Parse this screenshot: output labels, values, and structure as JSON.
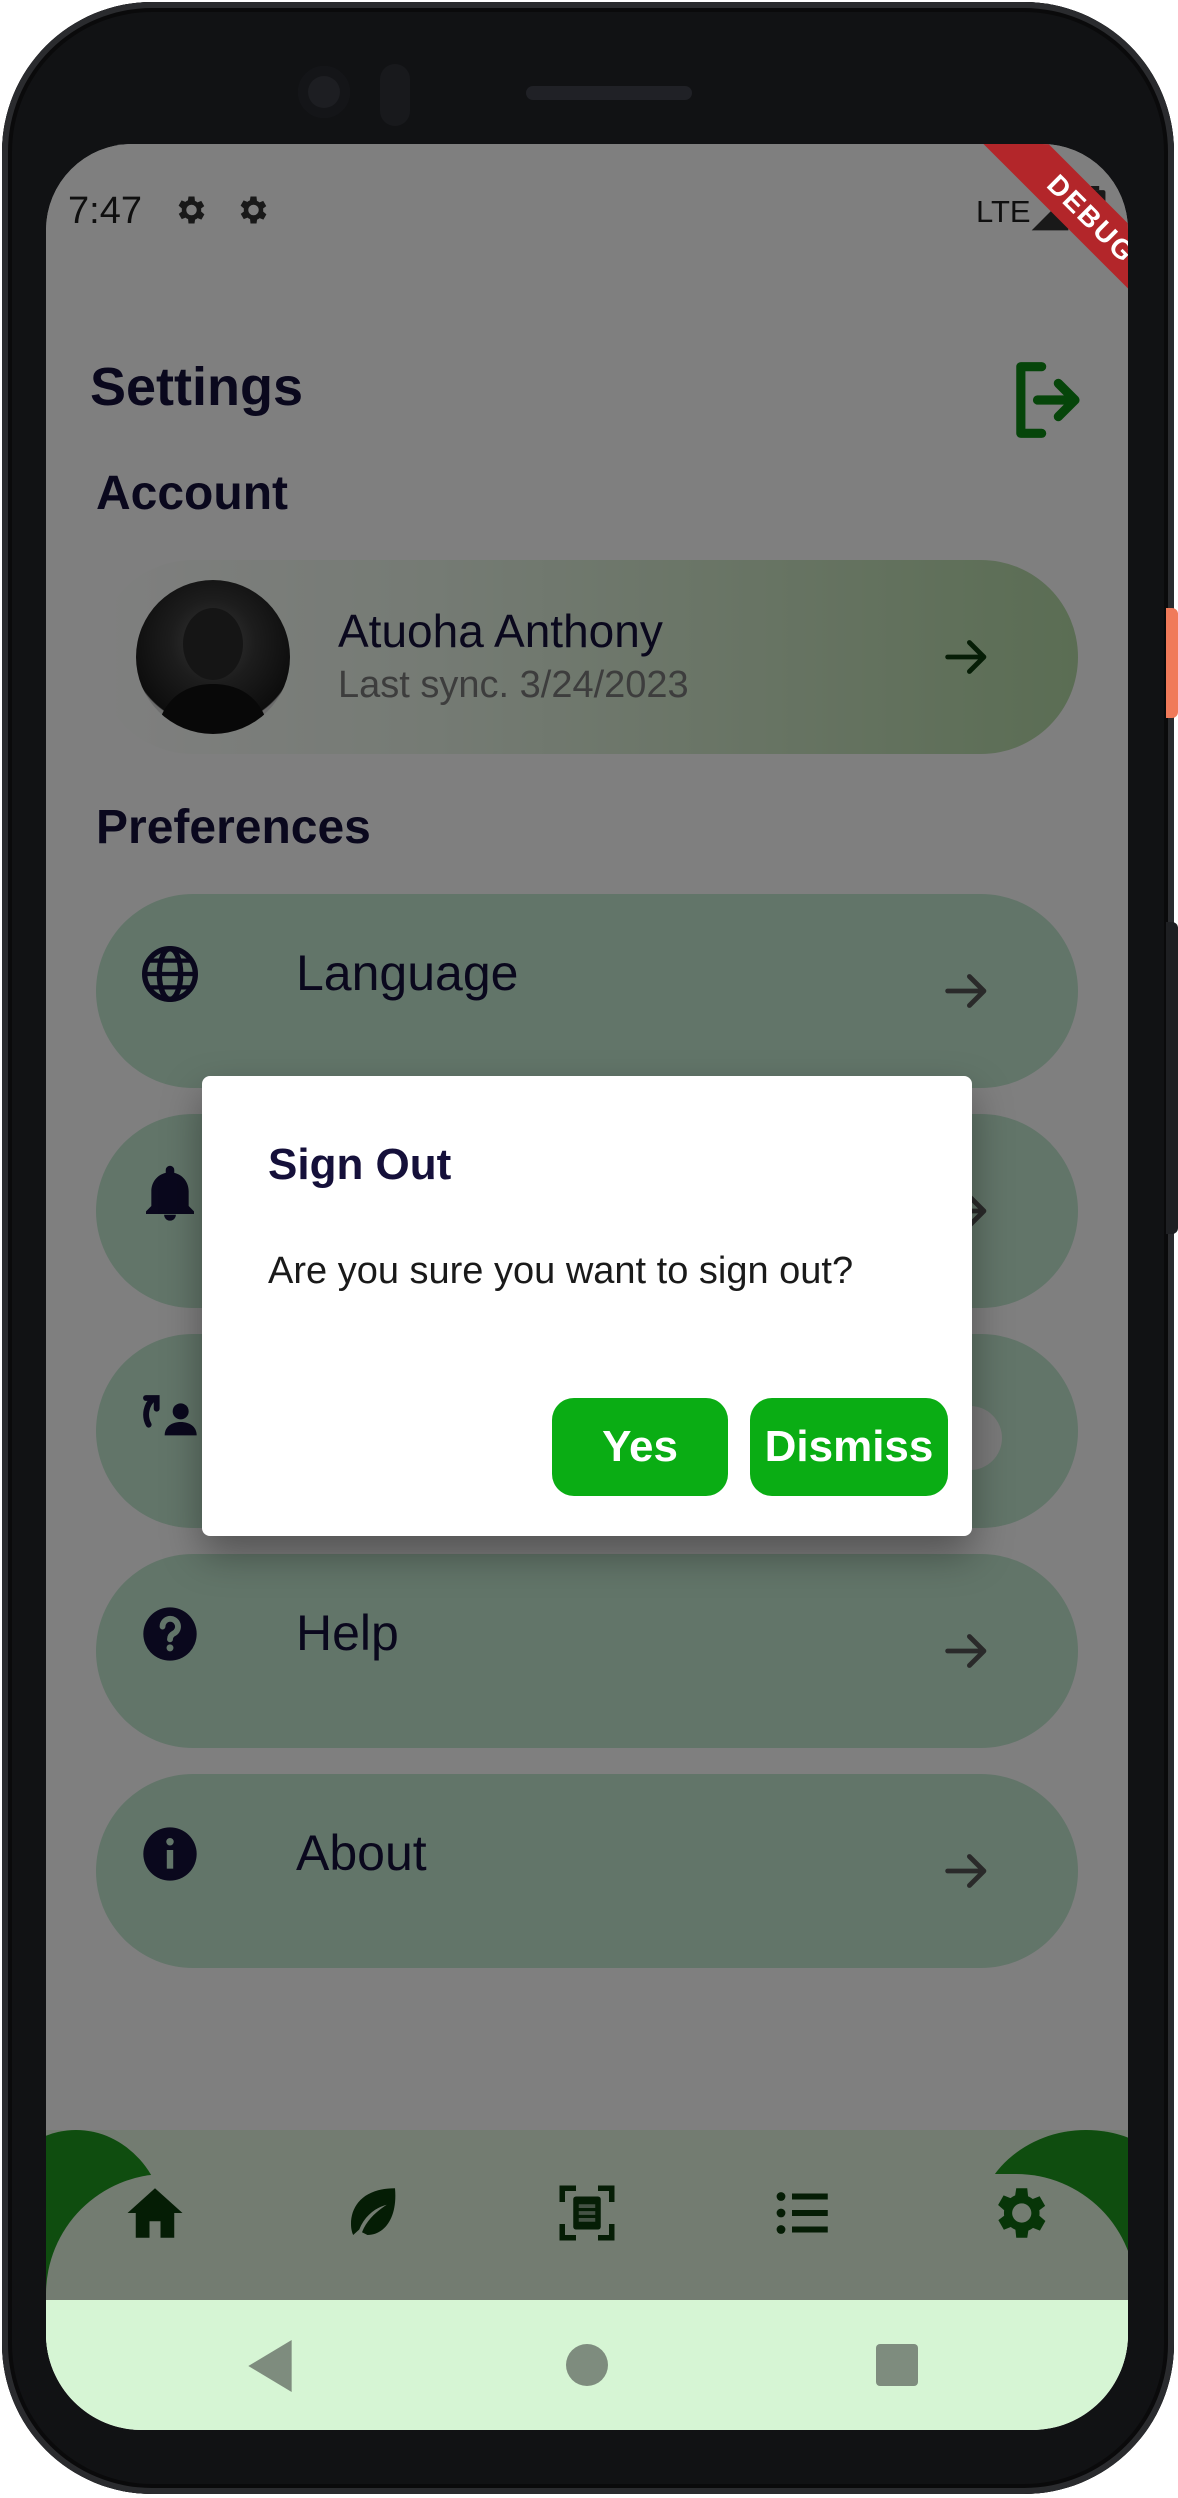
{
  "status_bar": {
    "time": "7:47",
    "network": "LTE",
    "debug_banner": "DEBUG"
  },
  "page": {
    "title": "Settings"
  },
  "account": {
    "section_title": "Account",
    "name": "Atuoha Anthony",
    "last_sync": "Last sync. 3/24/2023"
  },
  "preferences": {
    "section_title": "Preferences",
    "items": [
      {
        "label": "Language",
        "icon": "globe-icon"
      },
      {
        "label": "",
        "icon": "bell-icon"
      },
      {
        "label": "",
        "icon": "sync-icon"
      },
      {
        "label": "Help",
        "icon": "help-icon"
      },
      {
        "label": "About",
        "icon": "info-icon"
      }
    ]
  },
  "bottom_nav": {
    "items": [
      "home-icon",
      "leaf-icon",
      "scan-icon",
      "list-icon",
      "gear-icon"
    ],
    "active": "gear-icon"
  },
  "dialog": {
    "title": "Sign Out",
    "message": "Are you sure you want to sign out?",
    "confirm_label": "Yes",
    "dismiss_label": "Dismiss"
  },
  "colors": {
    "accent": "#0aad14",
    "brand_dark": "#15103a",
    "card_bg": "#c4ead3",
    "nav_bg": "#d6f5d4"
  }
}
